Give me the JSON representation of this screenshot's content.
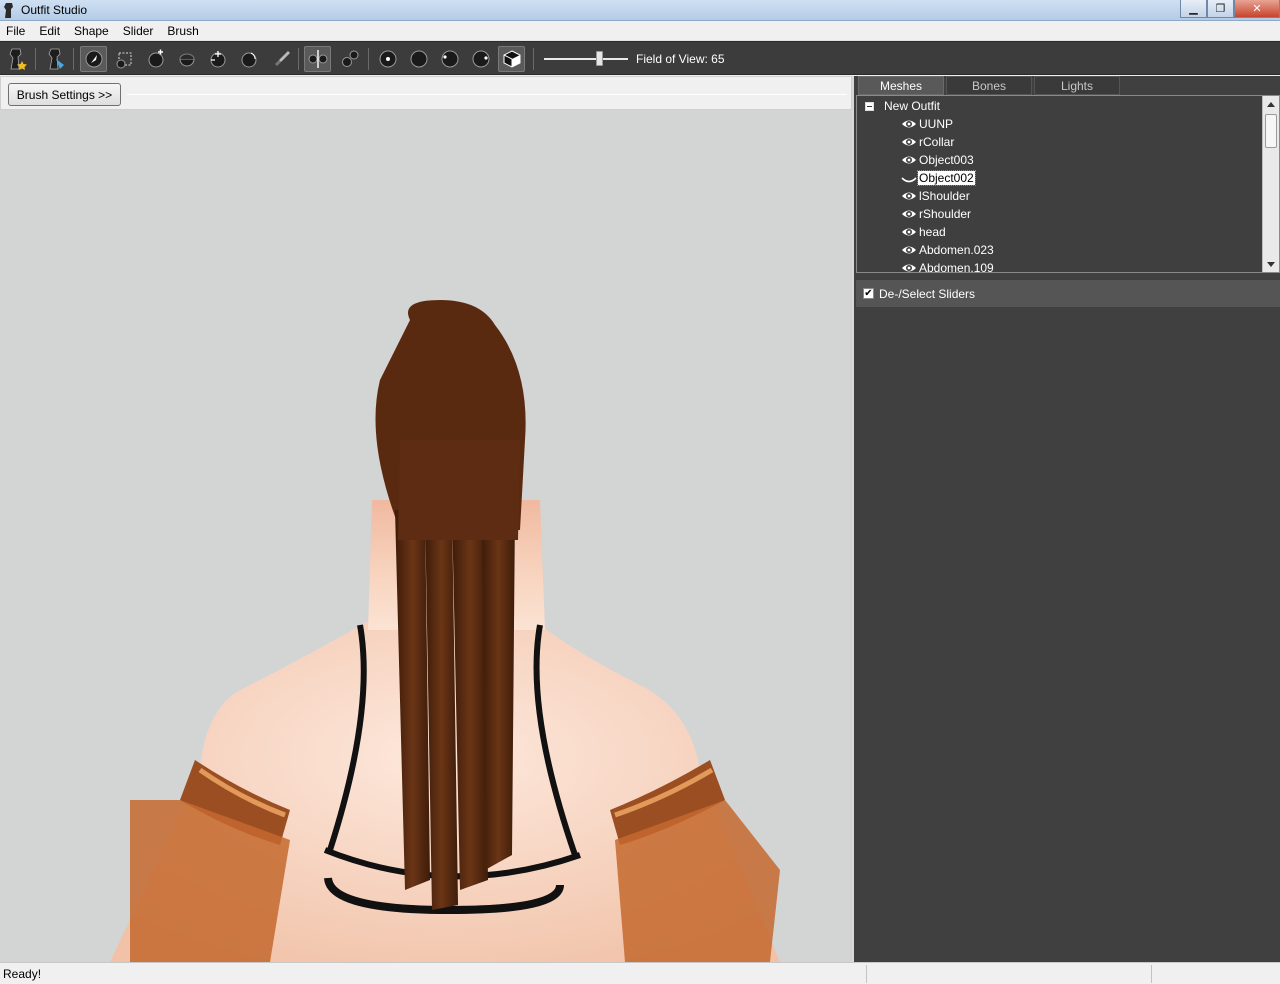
{
  "window": {
    "title": "Outfit Studio",
    "minimize": "▁",
    "maximize": "❐",
    "close": "✕"
  },
  "menu": [
    "File",
    "Edit",
    "Shape",
    "Slider",
    "Brush"
  ],
  "toolbar": {
    "fov_label": "Field of View: 65",
    "fov_value": 65,
    "fov_range": [
      15,
      90
    ]
  },
  "brush_settings_label": "Brush Settings >>",
  "tabs": [
    "Meshes",
    "Bones",
    "Lights"
  ],
  "tree": {
    "root": "New Outfit",
    "items": [
      {
        "label": "UUNP",
        "icon": "eye-icon"
      },
      {
        "label": "rCollar",
        "icon": "eye-icon"
      },
      {
        "label": "Object003",
        "icon": "eye-icon"
      },
      {
        "label": "Object002",
        "icon": "eye-closed-icon",
        "selected": true
      },
      {
        "label": "lShoulder",
        "icon": "eye-icon"
      },
      {
        "label": "rShoulder",
        "icon": "eye-icon"
      },
      {
        "label": "head",
        "icon": "eye-icon"
      },
      {
        "label": "Abdomen.023",
        "icon": "eye-icon"
      },
      {
        "label": "Abdomen.109",
        "icon": "eye-icon"
      }
    ]
  },
  "sliders_header": {
    "label": "De-/Select Sliders",
    "checked": true
  },
  "status": "Ready!",
  "colors": {
    "toolbar_bg": "#3c3c3c",
    "panel_bg": "#404040",
    "viewport_bg": "#d3d4d4",
    "hair": "#5a2c12",
    "skin": "#f3c4aa"
  }
}
